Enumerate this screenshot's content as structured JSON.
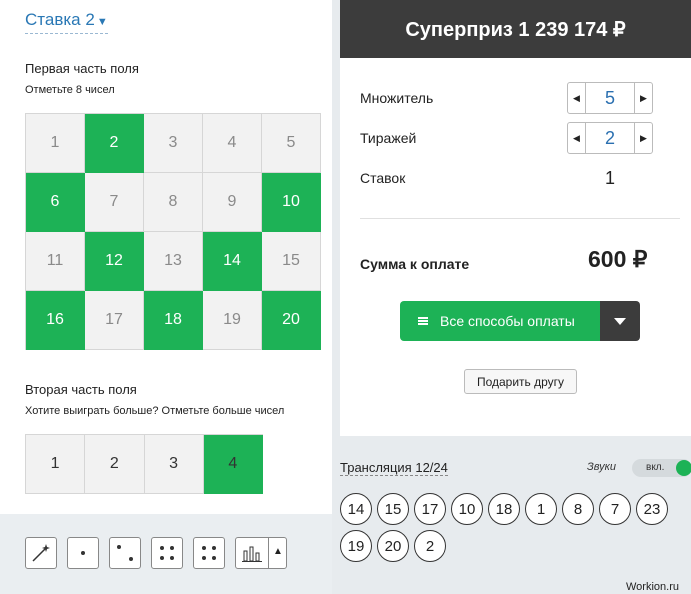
{
  "left": {
    "bet_title": "Ставка 2",
    "part1_title": "Первая часть поля",
    "part1_sub": "Отметьте 8 чисел",
    "grid1": [
      {
        "n": "1",
        "sel": false
      },
      {
        "n": "2",
        "sel": true
      },
      {
        "n": "3",
        "sel": false
      },
      {
        "n": "4",
        "sel": false
      },
      {
        "n": "5",
        "sel": false
      },
      {
        "n": "6",
        "sel": true
      },
      {
        "n": "7",
        "sel": false
      },
      {
        "n": "8",
        "sel": false
      },
      {
        "n": "9",
        "sel": false
      },
      {
        "n": "10",
        "sel": true
      },
      {
        "n": "11",
        "sel": false
      },
      {
        "n": "12",
        "sel": true
      },
      {
        "n": "13",
        "sel": false
      },
      {
        "n": "14",
        "sel": true
      },
      {
        "n": "15",
        "sel": false
      },
      {
        "n": "16",
        "sel": true
      },
      {
        "n": "17",
        "sel": false
      },
      {
        "n": "18",
        "sel": true
      },
      {
        "n": "19",
        "sel": false
      },
      {
        "n": "20",
        "sel": true
      }
    ],
    "part2_title": "Вторая часть поля",
    "part2_sub": "Хотите выиграть больше? Отметьте больше чисел",
    "grid2": [
      {
        "n": "1",
        "sel": false
      },
      {
        "n": "2",
        "sel": false
      },
      {
        "n": "3",
        "sel": false
      },
      {
        "n": "4",
        "sel": true
      }
    ],
    "toolbar_icons": [
      "magic-wand-icon",
      "dice-one-icon",
      "dice-two-icon",
      "dice-four-icon",
      "dice-four-alt-icon",
      "bar-chart-icon",
      "caret-up-icon"
    ]
  },
  "right": {
    "superprize": "Суперприз 1 239 174 ₽",
    "multiplier_label": "Множитель",
    "multiplier_value": "5",
    "draws_label": "Тиражей",
    "draws_value": "2",
    "bets_label": "Ставок",
    "bets_value": "1",
    "total_label": "Сумма к оплате",
    "total_value": "600 ₽",
    "pay_label": "Все способы оплаты",
    "gift_label": "Подарить другу"
  },
  "broadcast": {
    "label": "Трансляция 12/24",
    "sounds_label": "Звуки",
    "toggle_label": "вкл.",
    "balls": [
      "14",
      "15",
      "17",
      "10",
      "18",
      "1",
      "8",
      "7",
      "23",
      "19",
      "20",
      "2"
    ]
  },
  "watermark": "Workion.ru",
  "colors": {
    "selected": "#1db256",
    "header": "#3c3c3c",
    "link": "#2a78b5"
  }
}
